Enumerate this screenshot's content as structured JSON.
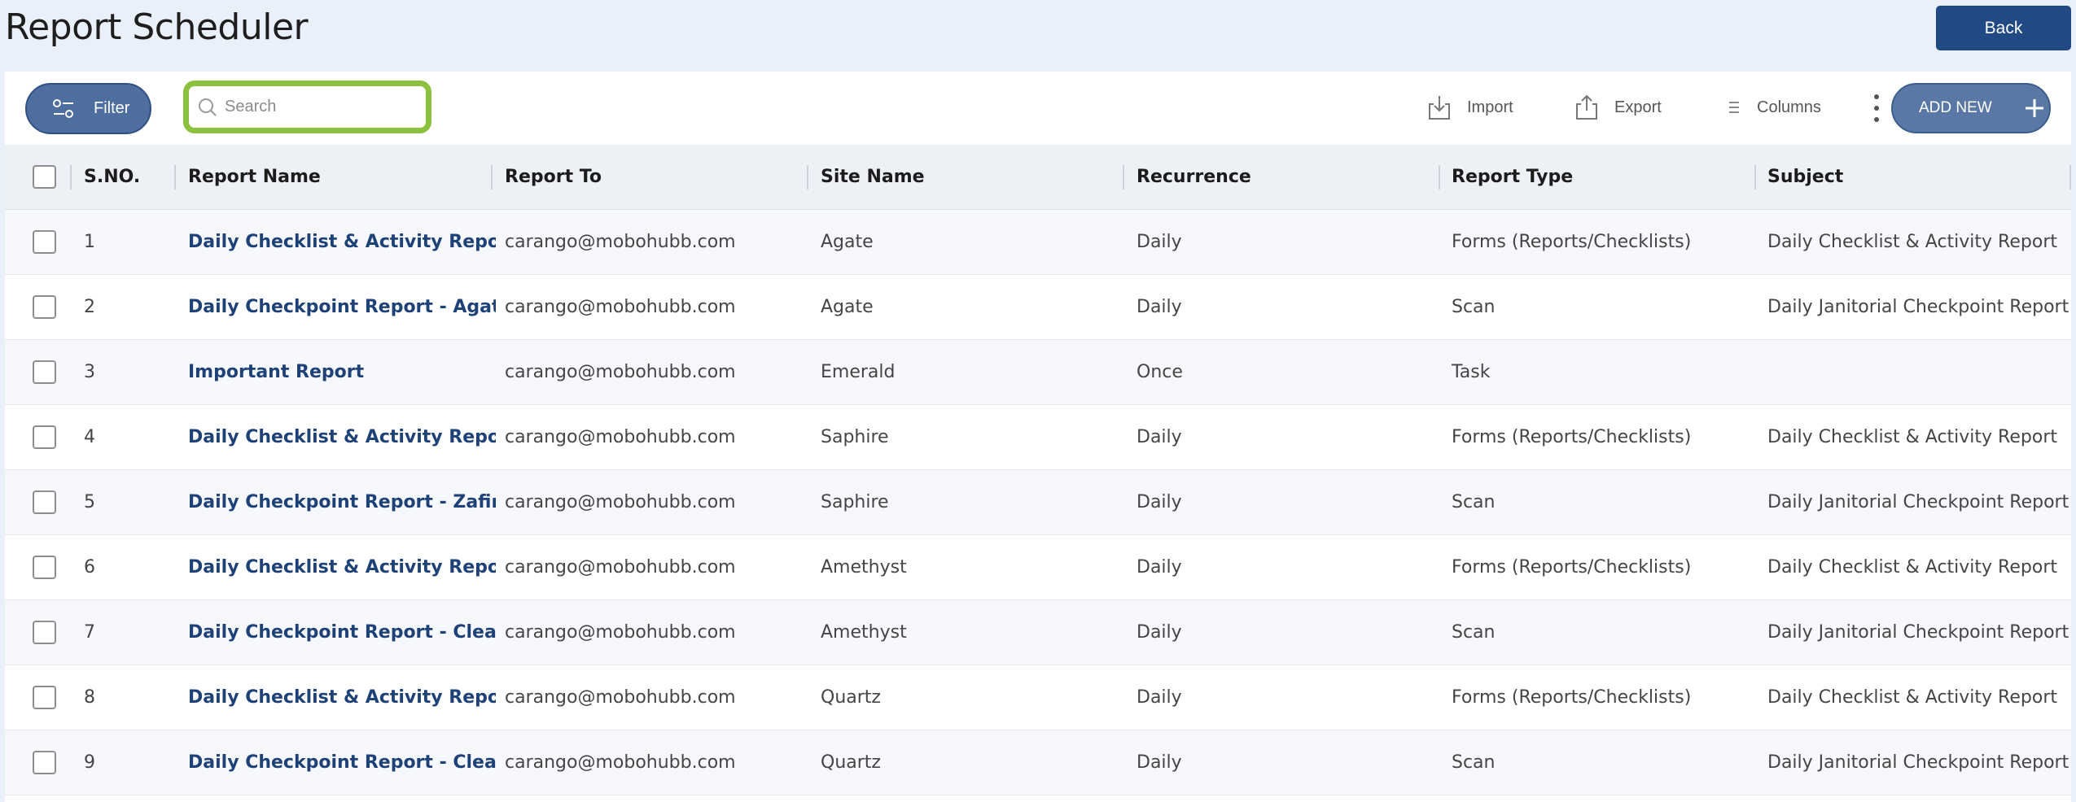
{
  "header": {
    "title": "Report Scheduler",
    "back_label": "Back"
  },
  "toolbar": {
    "filter_label": "Filter",
    "search_placeholder": "Search",
    "search_value": "",
    "import_label": "Import",
    "export_label": "Export",
    "columns_label": "Columns",
    "add_label": "ADD NEW"
  },
  "colors": {
    "accent": "#214a85",
    "search_highlight": "#8cc13f",
    "link": "#1e4177"
  },
  "table": {
    "columns": [
      "S.NO.",
      "Report Name",
      "Report To",
      "Site Name",
      "Recurrence",
      "Report Type",
      "Subject"
    ],
    "rows": [
      {
        "sno": "1",
        "name": "Daily Checklist & Activity Report - Agate",
        "to": "carango@mobohubb.com",
        "site": "Agate",
        "recurrence": "Daily",
        "type": "Forms (Reports/Checklists)",
        "subject": "Daily Checklist & Activity Report"
      },
      {
        "sno": "2",
        "name": "Daily Checkpoint Report - Agate",
        "to": "carango@mobohubb.com",
        "site": "Agate",
        "recurrence": "Daily",
        "type": "Scan",
        "subject": "Daily Janitorial Checkpoint Report"
      },
      {
        "sno": "3",
        "name": "Important Report",
        "to": "carango@mobohubb.com",
        "site": "Emerald",
        "recurrence": "Once",
        "type": "Task",
        "subject": ""
      },
      {
        "sno": "4",
        "name": "Daily Checklist & Activity Report - Zafiro",
        "to": "carango@mobohubb.com",
        "site": "Saphire",
        "recurrence": "Daily",
        "type": "Forms (Reports/Checklists)",
        "subject": "Daily Checklist & Activity Report"
      },
      {
        "sno": "5",
        "name": "Daily Checkpoint Report - Zafiro",
        "to": "carango@mobohubb.com",
        "site": "Saphire",
        "recurrence": "Daily",
        "type": "Scan",
        "subject": "Daily Janitorial Checkpoint Report"
      },
      {
        "sno": "6",
        "name": "Daily Checklist & Activity Report - Cleaning",
        "to": "carango@mobohubb.com",
        "site": "Amethyst",
        "recurrence": "Daily",
        "type": "Forms (Reports/Checklists)",
        "subject": "Daily Checklist & Activity Report"
      },
      {
        "sno": "7",
        "name": "Daily Checkpoint Report - Cleaning",
        "to": "carango@mobohubb.com",
        "site": "Amethyst",
        "recurrence": "Daily",
        "type": "Scan",
        "subject": "Daily Janitorial Checkpoint Report"
      },
      {
        "sno": "8",
        "name": "Daily Checklist & Activity Report - Cleaning",
        "to": "carango@mobohubb.com",
        "site": "Quartz",
        "recurrence": "Daily",
        "type": "Forms (Reports/Checklists)",
        "subject": "Daily Checklist & Activity Report"
      },
      {
        "sno": "9",
        "name": "Daily Checkpoint Report - Cleaning",
        "to": "carango@mobohubb.com",
        "site": "Quartz",
        "recurrence": "Daily",
        "type": "Scan",
        "subject": "Daily Janitorial Checkpoint Report"
      }
    ]
  }
}
